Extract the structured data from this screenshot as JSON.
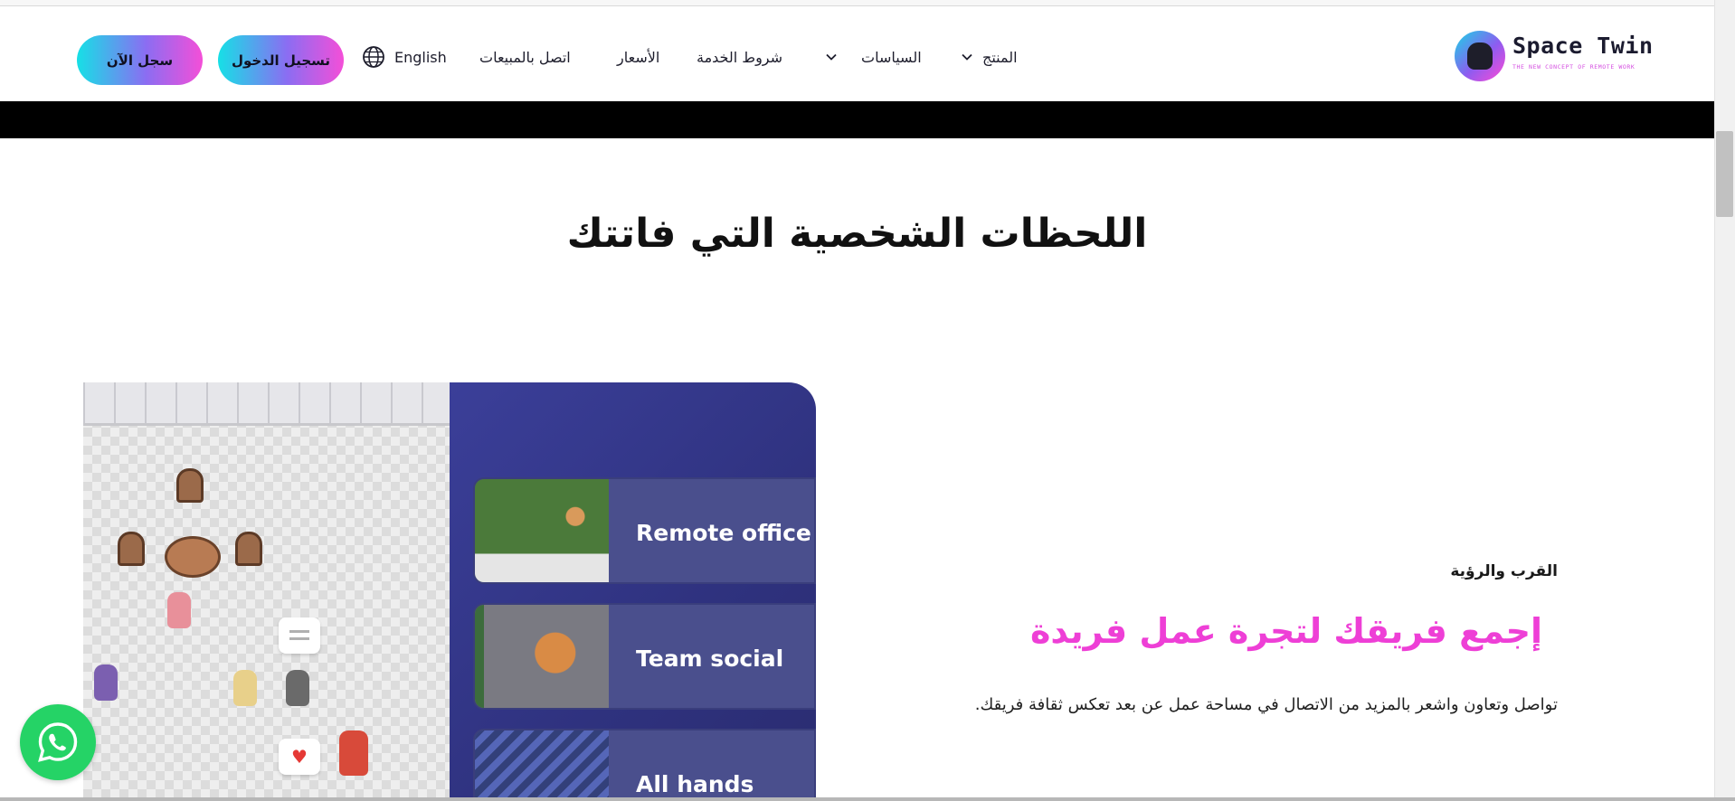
{
  "header": {
    "logo": {
      "name": "Space Twin",
      "tagline": "THE NEW CONCEPT OF REMOTE WORK"
    },
    "nav": {
      "product": "المنتج",
      "policies": "السياسات",
      "terms": "شروط الخدمة",
      "pricing": "الأسعار",
      "contact_sales": "اتصل بالمبيعات",
      "language": "English"
    },
    "login_label": "تسجيل الدخول",
    "signup_label": "سجل الآن"
  },
  "main": {
    "heading": "اللحظات الشخصية التي فاتتك",
    "rooms": [
      {
        "label": "Remote office"
      },
      {
        "label": "Team social"
      },
      {
        "label": "All hands"
      }
    ],
    "eyebrow": "القرب والرؤية",
    "sub_heading": "إجمع فريقك لتجرة عمل فريدة",
    "body": "تواصل وتعاون واشعر بالمزيد من الاتصال في مساحة عمل عن بعد تعكس ثقافة فريقك."
  },
  "icons": {
    "product_chevron": "chevron-down-icon",
    "policies_chevron": "chevron-down-icon",
    "language": "globe-icon",
    "whatsapp": "whatsapp-icon"
  },
  "colors": {
    "accent_pink": "#ee3fd6",
    "gradient_start": "#16e0e6",
    "gradient_end": "#f44fd8",
    "whatsapp": "#25d366",
    "panel_blue": "#2f327f"
  }
}
